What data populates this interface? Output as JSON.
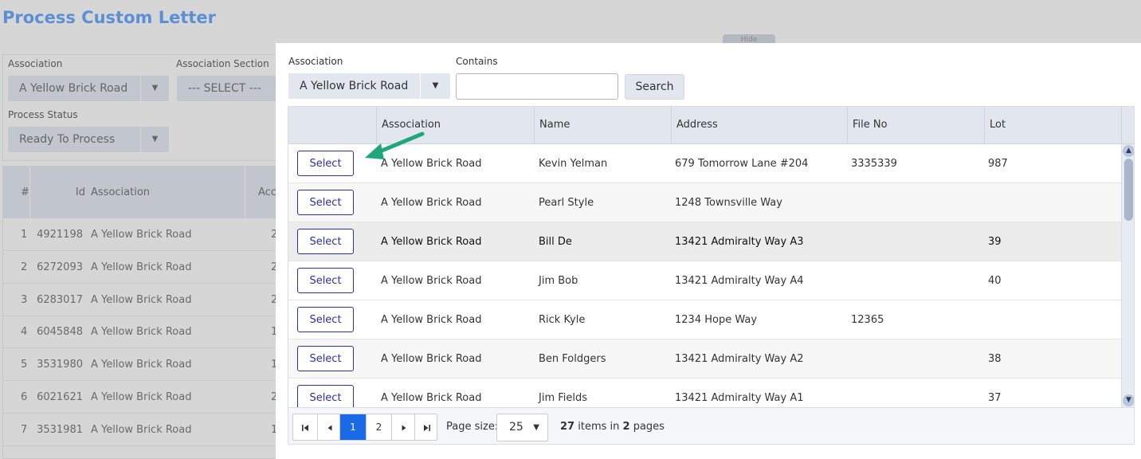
{
  "background": {
    "title": "Process Custom Letter",
    "hide_tab": "Hide",
    "filters": {
      "association_label": "Association",
      "association_value": "A Yellow Brick Road",
      "section_label": "Association Section",
      "section_value": "--- SELECT ---",
      "status_label": "Process Status",
      "status_value": "Ready To Process"
    },
    "grid": {
      "headers": {
        "num": "#",
        "id": "Id",
        "association": "Association",
        "acct": "Acco"
      },
      "rows": [
        {
          "num": "1",
          "id": "4921198",
          "association": "A Yellow Brick Road",
          "acct": "2"
        },
        {
          "num": "2",
          "id": "6272093",
          "association": "A Yellow Brick Road",
          "acct": "2"
        },
        {
          "num": "3",
          "id": "6283017",
          "association": "A Yellow Brick Road",
          "acct": "2"
        },
        {
          "num": "4",
          "id": "6045848",
          "association": "A Yellow Brick Road",
          "acct": "1"
        },
        {
          "num": "5",
          "id": "3531980",
          "association": "A Yellow Brick Road",
          "acct": "1"
        },
        {
          "num": "6",
          "id": "6021621",
          "association": "A Yellow Brick Road",
          "acct": "2"
        },
        {
          "num": "7",
          "id": "3531981",
          "association": "A Yellow Brick Road",
          "acct": "1"
        }
      ]
    }
  },
  "modal": {
    "association_label": "Association",
    "association_value": "A Yellow Brick Road",
    "contains_label": "Contains",
    "contains_value": "",
    "search_label": "Search",
    "grid": {
      "headers": {
        "association": "Association",
        "name": "Name",
        "address": "Address",
        "file_no": "File No",
        "lot": "Lot"
      },
      "select_label": "Select",
      "rows": [
        {
          "association": "A Yellow Brick Road",
          "name": "Kevin Yelman",
          "address": "679 Tomorrow Lane #204",
          "file_no": "3335339",
          "lot": "987"
        },
        {
          "association": "A Yellow Brick Road",
          "name": "Pearl Style",
          "address": "1248 Townsville Way",
          "file_no": "",
          "lot": ""
        },
        {
          "association": "A Yellow Brick Road",
          "name": "Bill De",
          "address": "13421 Admiralty Way A3",
          "file_no": "",
          "lot": "39"
        },
        {
          "association": "A Yellow Brick Road",
          "name": "Jim Bob",
          "address": "13421 Admiralty Way A4",
          "file_no": "",
          "lot": "40"
        },
        {
          "association": "A Yellow Brick Road",
          "name": "Rick Kyle",
          "address": "1234 Hope Way",
          "file_no": "12365",
          "lot": ""
        },
        {
          "association": "A Yellow Brick Road",
          "name": "Ben Foldgers",
          "address": "13421 Admiralty Way A2",
          "file_no": "",
          "lot": "38"
        },
        {
          "association": "A Yellow Brick Road",
          "name": "Jim Fields",
          "address": "13421 Admiralty Way A1",
          "file_no": "",
          "lot": "37"
        }
      ]
    },
    "pager": {
      "first_icon": "first-page-icon",
      "prev_icon": "prev-page-icon",
      "next_icon": "next-page-icon",
      "last_icon": "last-page-icon",
      "pages": [
        "1",
        "2"
      ],
      "current_page": "1",
      "page_size_label": "Page size:",
      "page_size": "25",
      "items_count": "27",
      "items_text": "items in",
      "pages_count": "2",
      "pages_text": "pages"
    }
  },
  "colors": {
    "title": "#5b8fd6",
    "accent": "#1a6ae8",
    "select_button": "#2d2fa6",
    "annotation_arrow": "#1fa67a"
  }
}
